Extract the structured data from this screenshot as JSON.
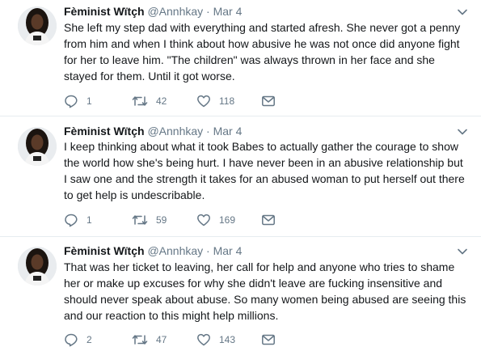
{
  "tweets": [
    {
      "name": "Fèminist Wïtçh",
      "handle": "@Annhkay",
      "separator": "·",
      "date": "Mar 4",
      "text": "She left my step dad with everything and started afresh. She never got a penny from him and when I think about how abusive he was not once  did anyone fight for her to leave him. \"The children\" was always thrown in her face and she stayed for them. Until it got worse.",
      "replies": "1",
      "retweets": "42",
      "likes": "118"
    },
    {
      "name": "Fèminist Wïtçh",
      "handle": "@Annhkay",
      "separator": "·",
      "date": "Mar 4",
      "text": "I keep thinking about what it took Babes to actually gather the courage to show the world how she's being hurt. I have never been in an abusive relationship but I saw one and the strength it takes for an abused woman to put herself out there to get help is undescribable.",
      "replies": "1",
      "retweets": "59",
      "likes": "169"
    },
    {
      "name": "Fèminist Wïtçh",
      "handle": "@Annhkay",
      "separator": "·",
      "date": "Mar 4",
      "text": "That was her ticket to leaving, her call for help and anyone who tries to shame her or make up excuses for why she didn't leave are fucking insensitive and should never speak about abuse. So many women being abused are seeing this and our reaction to this might help millions.",
      "replies": "2",
      "retweets": "47",
      "likes": "143"
    }
  ],
  "icons": {
    "reply": "reply-icon",
    "retweet": "retweet-icon",
    "like": "heart-icon",
    "message": "envelope-icon",
    "caret": "chevron-down-icon"
  },
  "colors": {
    "text": "#14171a",
    "secondary": "#657786",
    "divider": "#e6ecf0"
  }
}
